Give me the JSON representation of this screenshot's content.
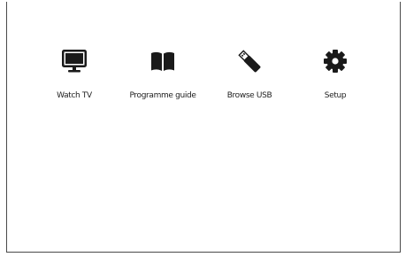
{
  "menu": {
    "items": [
      {
        "label": "Watch TV",
        "icon": "tv-icon"
      },
      {
        "label": "Programme guide",
        "icon": "book-icon"
      },
      {
        "label": "Browse USB",
        "icon": "usb-stick-icon"
      },
      {
        "label": "Setup",
        "icon": "gear-icon"
      }
    ]
  },
  "colors": {
    "icon": "#1a1a1a",
    "text": "#222222",
    "background": "#ffffff",
    "border": "#4a4a4a"
  }
}
